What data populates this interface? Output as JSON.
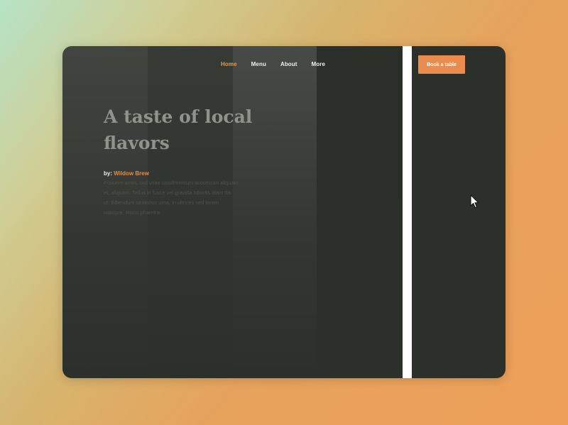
{
  "nav": {
    "items": [
      {
        "label": "Home",
        "active": true
      },
      {
        "label": "Menu",
        "active": false
      },
      {
        "label": "About",
        "active": false
      },
      {
        "label": "More",
        "active": false
      }
    ]
  },
  "cta": {
    "label": "Book a table"
  },
  "hero": {
    "title": "A taste of local flavors",
    "byline_prefix": "by:",
    "author": "Wildow Brew",
    "body": "Posuere amet, sed vitae condimentum accumsan aliquam et, aliquam. Tellus in fusce vel gravida lobortis diam dis ut. Bibendum senectus urna, in ultrices sed lorem natoque. Risus pharetra"
  },
  "colors": {
    "accent": "#e98c4e",
    "background_dark": "#2c302b",
    "divider": "#ffffff"
  },
  "icons": {
    "cursor": "mouse-pointer-icon"
  }
}
